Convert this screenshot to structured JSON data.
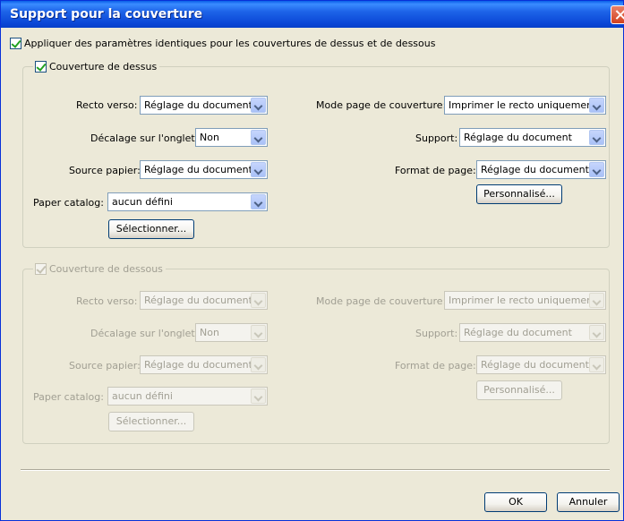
{
  "window": {
    "title": "Support pour la couverture"
  },
  "apply_same": {
    "label": "Appliquer des paramètres identiques pour les couvertures de dessus et de dessous",
    "checked": true
  },
  "top_cover": {
    "legend": "Couverture de dessus",
    "checked": true,
    "duplex": {
      "label": "Recto verso:",
      "value": "Réglage du document"
    },
    "tab_shift": {
      "label": "Décalage sur l'onglet:",
      "value": "Non"
    },
    "paper_source": {
      "label": "Source papier:",
      "value": "Réglage du document"
    },
    "paper_catalog": {
      "label": "Paper catalog:",
      "value": "aucun défini"
    },
    "select_button": "Sélectionner...",
    "cover_page_mode": {
      "label": "Mode page de couverture:",
      "value": "Imprimer le recto uniquement"
    },
    "media": {
      "label": "Support:",
      "value": "Réglage du document"
    },
    "page_size": {
      "label": "Format de page:",
      "value": "Réglage du document"
    },
    "custom_button": "Personnalisé..."
  },
  "bottom_cover": {
    "legend": "Couverture de dessous",
    "checked": true,
    "duplex": {
      "label": "Recto verso:",
      "value": "Réglage du document"
    },
    "tab_shift": {
      "label": "Décalage sur l'onglet:",
      "value": "Non"
    },
    "paper_source": {
      "label": "Source papier:",
      "value": "Réglage du document"
    },
    "paper_catalog": {
      "label": "Paper catalog:",
      "value": "aucun défini"
    },
    "select_button": "Sélectionner...",
    "cover_page_mode": {
      "label": "Mode page de couverture:",
      "value": "Imprimer le recto uniquement"
    },
    "media": {
      "label": "Support:",
      "value": "Réglage du document"
    },
    "page_size": {
      "label": "Format de page:",
      "value": "Réglage du document"
    },
    "custom_button": "Personnalisé..."
  },
  "footer": {
    "ok": "OK",
    "cancel": "Annuler"
  }
}
